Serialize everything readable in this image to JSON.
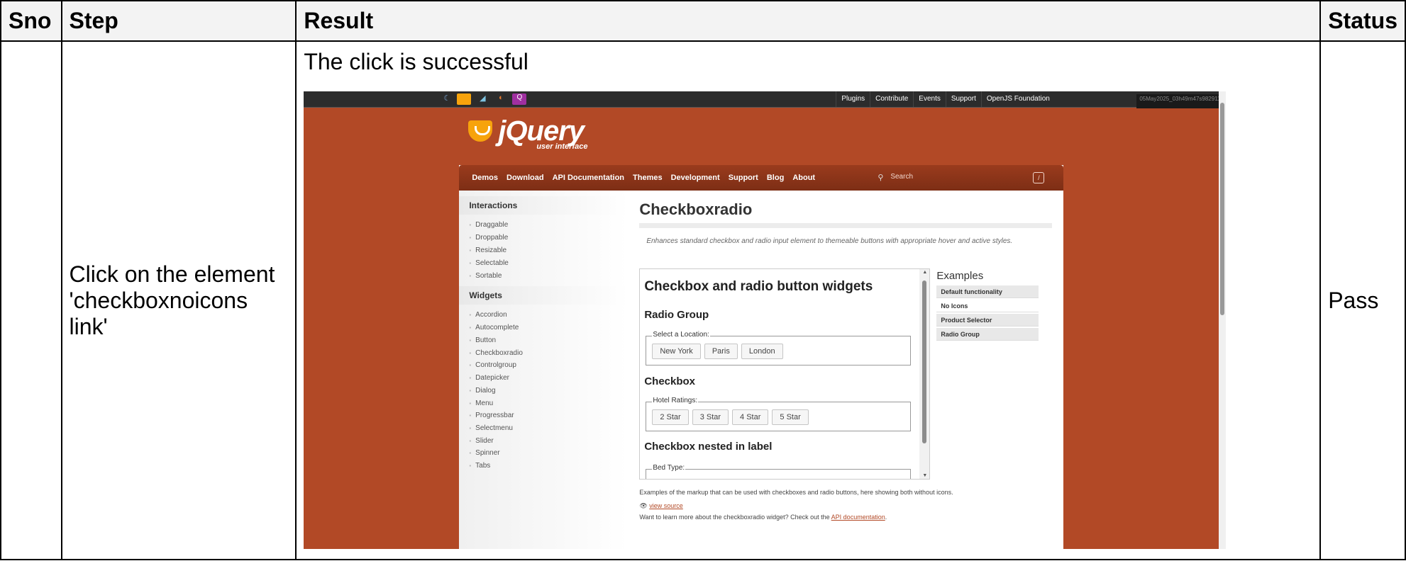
{
  "headers": {
    "sno": "Sno",
    "step": "Step",
    "result": "Result",
    "status": "Status"
  },
  "row": {
    "sno": "",
    "step": "Click on the element 'checkboxnoicons link'",
    "result_text": "The click is successful",
    "status": "Pass"
  },
  "screenshot": {
    "topbar": {
      "links": [
        "Plugins",
        "Contribute",
        "Events",
        "Support",
        "OpenJS Foundation"
      ],
      "stamp": "05May2025_03h49m47s982911"
    },
    "logo": {
      "word": "jQuery",
      "sub": "user interface"
    },
    "nav": [
      "Demos",
      "Download",
      "API Documentation",
      "Themes",
      "Development",
      "Support",
      "Blog",
      "About"
    ],
    "search_placeholder": "Search",
    "search_shortcut": "/",
    "sidebar": {
      "interactions_title": "Interactions",
      "interactions": [
        "Draggable",
        "Droppable",
        "Resizable",
        "Selectable",
        "Sortable"
      ],
      "widgets_title": "Widgets",
      "widgets": [
        "Accordion",
        "Autocomplete",
        "Button",
        "Checkboxradio",
        "Controlgroup",
        "Datepicker",
        "Dialog",
        "Menu",
        "Progressbar",
        "Selectmenu",
        "Slider",
        "Spinner",
        "Tabs"
      ]
    },
    "main": {
      "title": "Checkboxradio",
      "description": "Enhances standard checkbox and radio input element to themeable buttons with appropriate hover and active styles.",
      "demo": {
        "heading": "Checkbox and radio button widgets",
        "radio_title": "Radio Group",
        "radio_legend": "Select a Location:",
        "radio_options": [
          "New York",
          "Paris",
          "London"
        ],
        "checkbox_title": "Checkbox",
        "checkbox_legend": "Hotel Ratings:",
        "checkbox_options": [
          "2 Star",
          "3 Star",
          "4 Star",
          "5 Star"
        ],
        "nested_title": "Checkbox nested in label",
        "nested_legend": "Bed Type:"
      },
      "examples_title": "Examples",
      "examples": [
        "Default functionality",
        "No Icons",
        "Product Selector",
        "Radio Group"
      ],
      "caption": "Examples of the markup that can be used with checkboxes and radio buttons, here showing both without icons.",
      "view_source": "view source",
      "learn_more_prefix": "Want to learn more about the checkboxradio widget? Check out the",
      "api_link": "API documentation",
      "learn_more_suffix": "."
    }
  },
  "colors": {
    "page_bg": "#b24926",
    "nav_bg": "#7d2e15",
    "logo_accent": "#f7a30c"
  }
}
